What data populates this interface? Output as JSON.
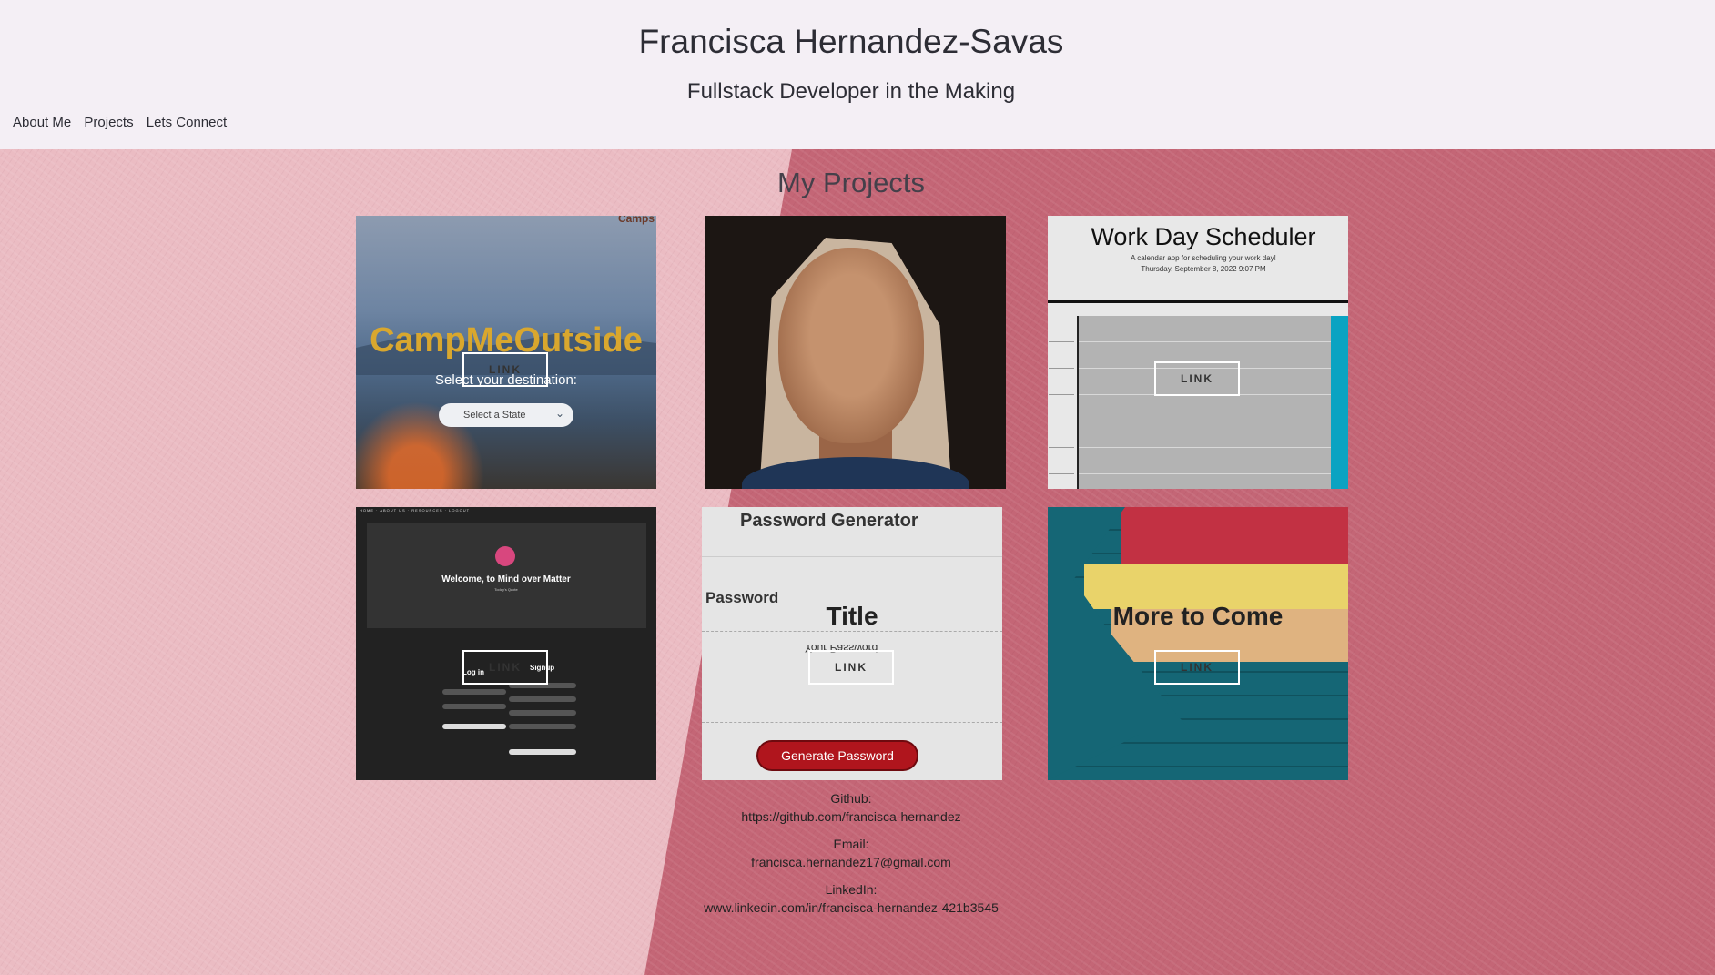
{
  "header": {
    "name": "Francisca Hernandez-Savas",
    "tagline": "Fullstack Developer in the Making",
    "nav": [
      "About Me",
      "Projects",
      "Lets Connect"
    ]
  },
  "projects": {
    "heading": "My Projects",
    "link_label": "LINK",
    "cards": [
      {
        "screenshot": {
          "brand": "CampMeOutside",
          "corner_text": "Camps",
          "select_label": "Select your destination:",
          "select_value": "Select a State"
        }
      },
      {
        "screenshot": {
          "subject": "portrait photo"
        }
      },
      {
        "screenshot": {
          "title": "Work Day Scheduler",
          "subtitle": "A calendar app for scheduling your work day!",
          "date": "Thursday, September 8, 2022 9:07 PM"
        }
      },
      {
        "screenshot": {
          "welcome": "Welcome, to Mind over Matter",
          "quote": "Today's Quote",
          "login": "Log in",
          "signup": "Signup"
        }
      },
      {
        "title": "Title",
        "screenshot": {
          "heading": "Password Generator",
          "password_label": "Password",
          "placeholder": "Your Password",
          "button": "Generate Password"
        }
      },
      {
        "title": "More to Come"
      }
    ]
  },
  "contact": {
    "github_label": "Github:",
    "github_url": "https://github.com/francisca-hernandez",
    "email_label": "Email:",
    "email": "francisca.hernandez17@gmail.com",
    "linkedin_label": "LinkedIn:",
    "linkedin_url": "www.linkedin.com/in/francisca-hernandez-421b3545"
  },
  "colors": {
    "header_bg": "#f4eff5",
    "wall_light": "#ebbcc3",
    "wall_dark": "#c46676",
    "button_red": "#b0151d"
  }
}
